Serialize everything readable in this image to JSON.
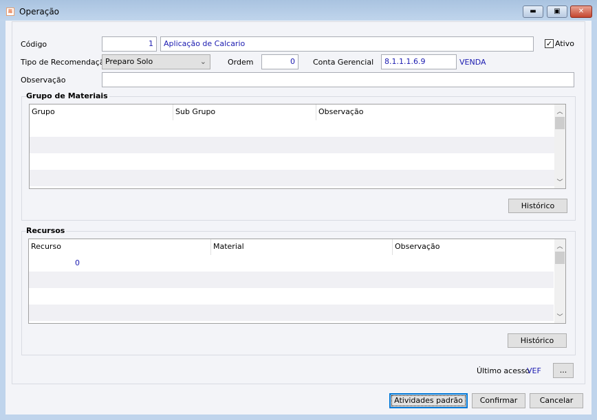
{
  "window": {
    "title": "Operação",
    "minimize": "minimize",
    "maximize": "maximize",
    "close": "close"
  },
  "form": {
    "codigo_label": "Código",
    "codigo_value": "1",
    "descricao_value": "Aplicação de Calcario",
    "ativo_label": "Ativo",
    "ativo_checked": true,
    "tipo_label": "Tipo de Recomendação",
    "tipo_value": "Preparo Solo",
    "ordem_label": "Ordem",
    "ordem_value": "0",
    "conta_label": "Conta Gerencial",
    "conta_value": "8.1.1.1.6.9",
    "conta_desc": "VENDA",
    "obs_label": "Observação",
    "obs_value": ""
  },
  "grupo": {
    "title": "Grupo de Materiais",
    "columns": [
      "Grupo",
      "Sub Grupo",
      "Observação"
    ],
    "rows": [],
    "historico": "Histórico"
  },
  "recursos": {
    "title": "Recursos",
    "columns": [
      "Recurso",
      "Material",
      "Observação"
    ],
    "rows": [
      [
        "0",
        "",
        ""
      ]
    ],
    "historico": "Histórico"
  },
  "footer": {
    "ultimo_label": "Último acesso",
    "ultimo_value": "VEF",
    "more": "...",
    "atividades": "Atividades padrão",
    "confirmar": "Confirmar",
    "cancelar": "Cancelar"
  }
}
